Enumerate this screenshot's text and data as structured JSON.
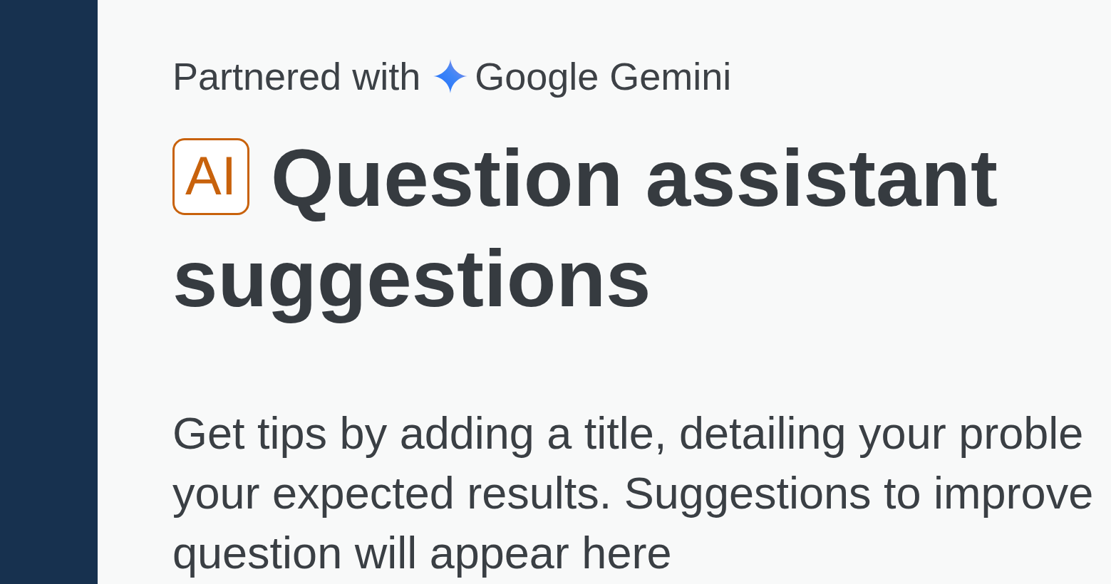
{
  "partner": {
    "prefix": "Partnered with",
    "name": "Google Gemini"
  },
  "heading": {
    "badge": "AI",
    "title": "Question assistant suggestions"
  },
  "description": {
    "lines": [
      "Get tips by adding a title, detailing your proble",
      "your expected results. Suggestions to improve",
      "question will appear here"
    ]
  }
}
